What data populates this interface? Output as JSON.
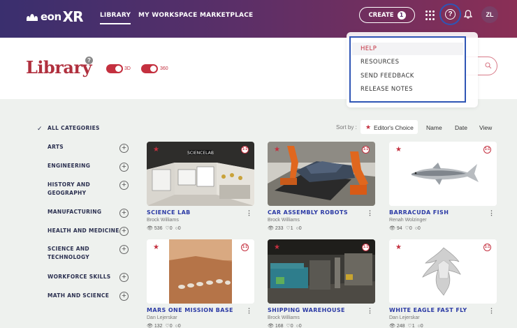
{
  "brand": {
    "name_part1": "eon",
    "name_part2": "XR"
  },
  "nav": {
    "library": "LIBRARY",
    "workspace": "MY WORKSPACE",
    "marketplace": "MARKETPLACE"
  },
  "create": {
    "label": "CREATE",
    "badge": "1"
  },
  "avatar": "ZL",
  "icons": [
    "apps-grid-icon",
    "help-icon",
    "bell-icon",
    "search-icon",
    "eye-icon",
    "heart-icon",
    "comment-icon",
    "star-icon",
    "plus-icon"
  ],
  "page": {
    "title": "Library",
    "help": "?"
  },
  "toggles": [
    {
      "label": "3D",
      "on": true
    },
    {
      "label": "360",
      "on": true
    }
  ],
  "help_menu": {
    "items": [
      "HELP",
      "RESOURCES",
      "SEND FEEDBACK",
      "RELEASE NOTES"
    ],
    "highlighted": "HELP"
  },
  "sidebar": {
    "all": "ALL CATEGORIES",
    "categories": [
      "ARTS",
      "ENGINEERING",
      "HISTORY AND GEOGRAPHY",
      "MANUFACTURING",
      "HEALTH AND MEDICINE",
      "SCIENCE AND TECHNOLOGY",
      "WORKFORCE SKILLS",
      "MATH AND SCIENCE"
    ]
  },
  "sort": {
    "label": "Sort by :",
    "options": [
      "Editor's Choice",
      "Name",
      "Date",
      "View"
    ],
    "active": "Editor's Choice"
  },
  "cards": [
    {
      "title": "SCIENCE LAB",
      "author": "Brock Williams",
      "views": "536",
      "likes": "0",
      "comments": "0",
      "badge": "1:1",
      "sign": "SCIENCELAB"
    },
    {
      "title": "CAR ASSEMBLY ROBOTS",
      "author": "Brock Williams",
      "views": "233",
      "likes": "1",
      "comments": "0",
      "badge": "1:1"
    },
    {
      "title": "BARRACUDA FISH",
      "author": "Renah Wolzinger",
      "views": "94",
      "likes": "0",
      "comments": "0",
      "badge": "1:1"
    },
    {
      "title": "MARS ONE MISSION BASE",
      "author": "Dan Lejerskar",
      "views": "132",
      "likes": "0",
      "comments": "0",
      "badge": "1:1"
    },
    {
      "title": "SHIPPING WAREHOUSE",
      "author": "Brock Williams",
      "views": "168",
      "likes": "0",
      "comments": "0",
      "badge": "1:1"
    },
    {
      "title": "WHITE EAGLE FAST FLY",
      "author": "Dan Lejerskar",
      "views": "248",
      "likes": "1",
      "comments": "0",
      "badge": "1:1"
    }
  ],
  "colors": {
    "accent": "#c4303f",
    "focus_ring": "#2f55b5",
    "title_blue": "#2b3aa5"
  }
}
